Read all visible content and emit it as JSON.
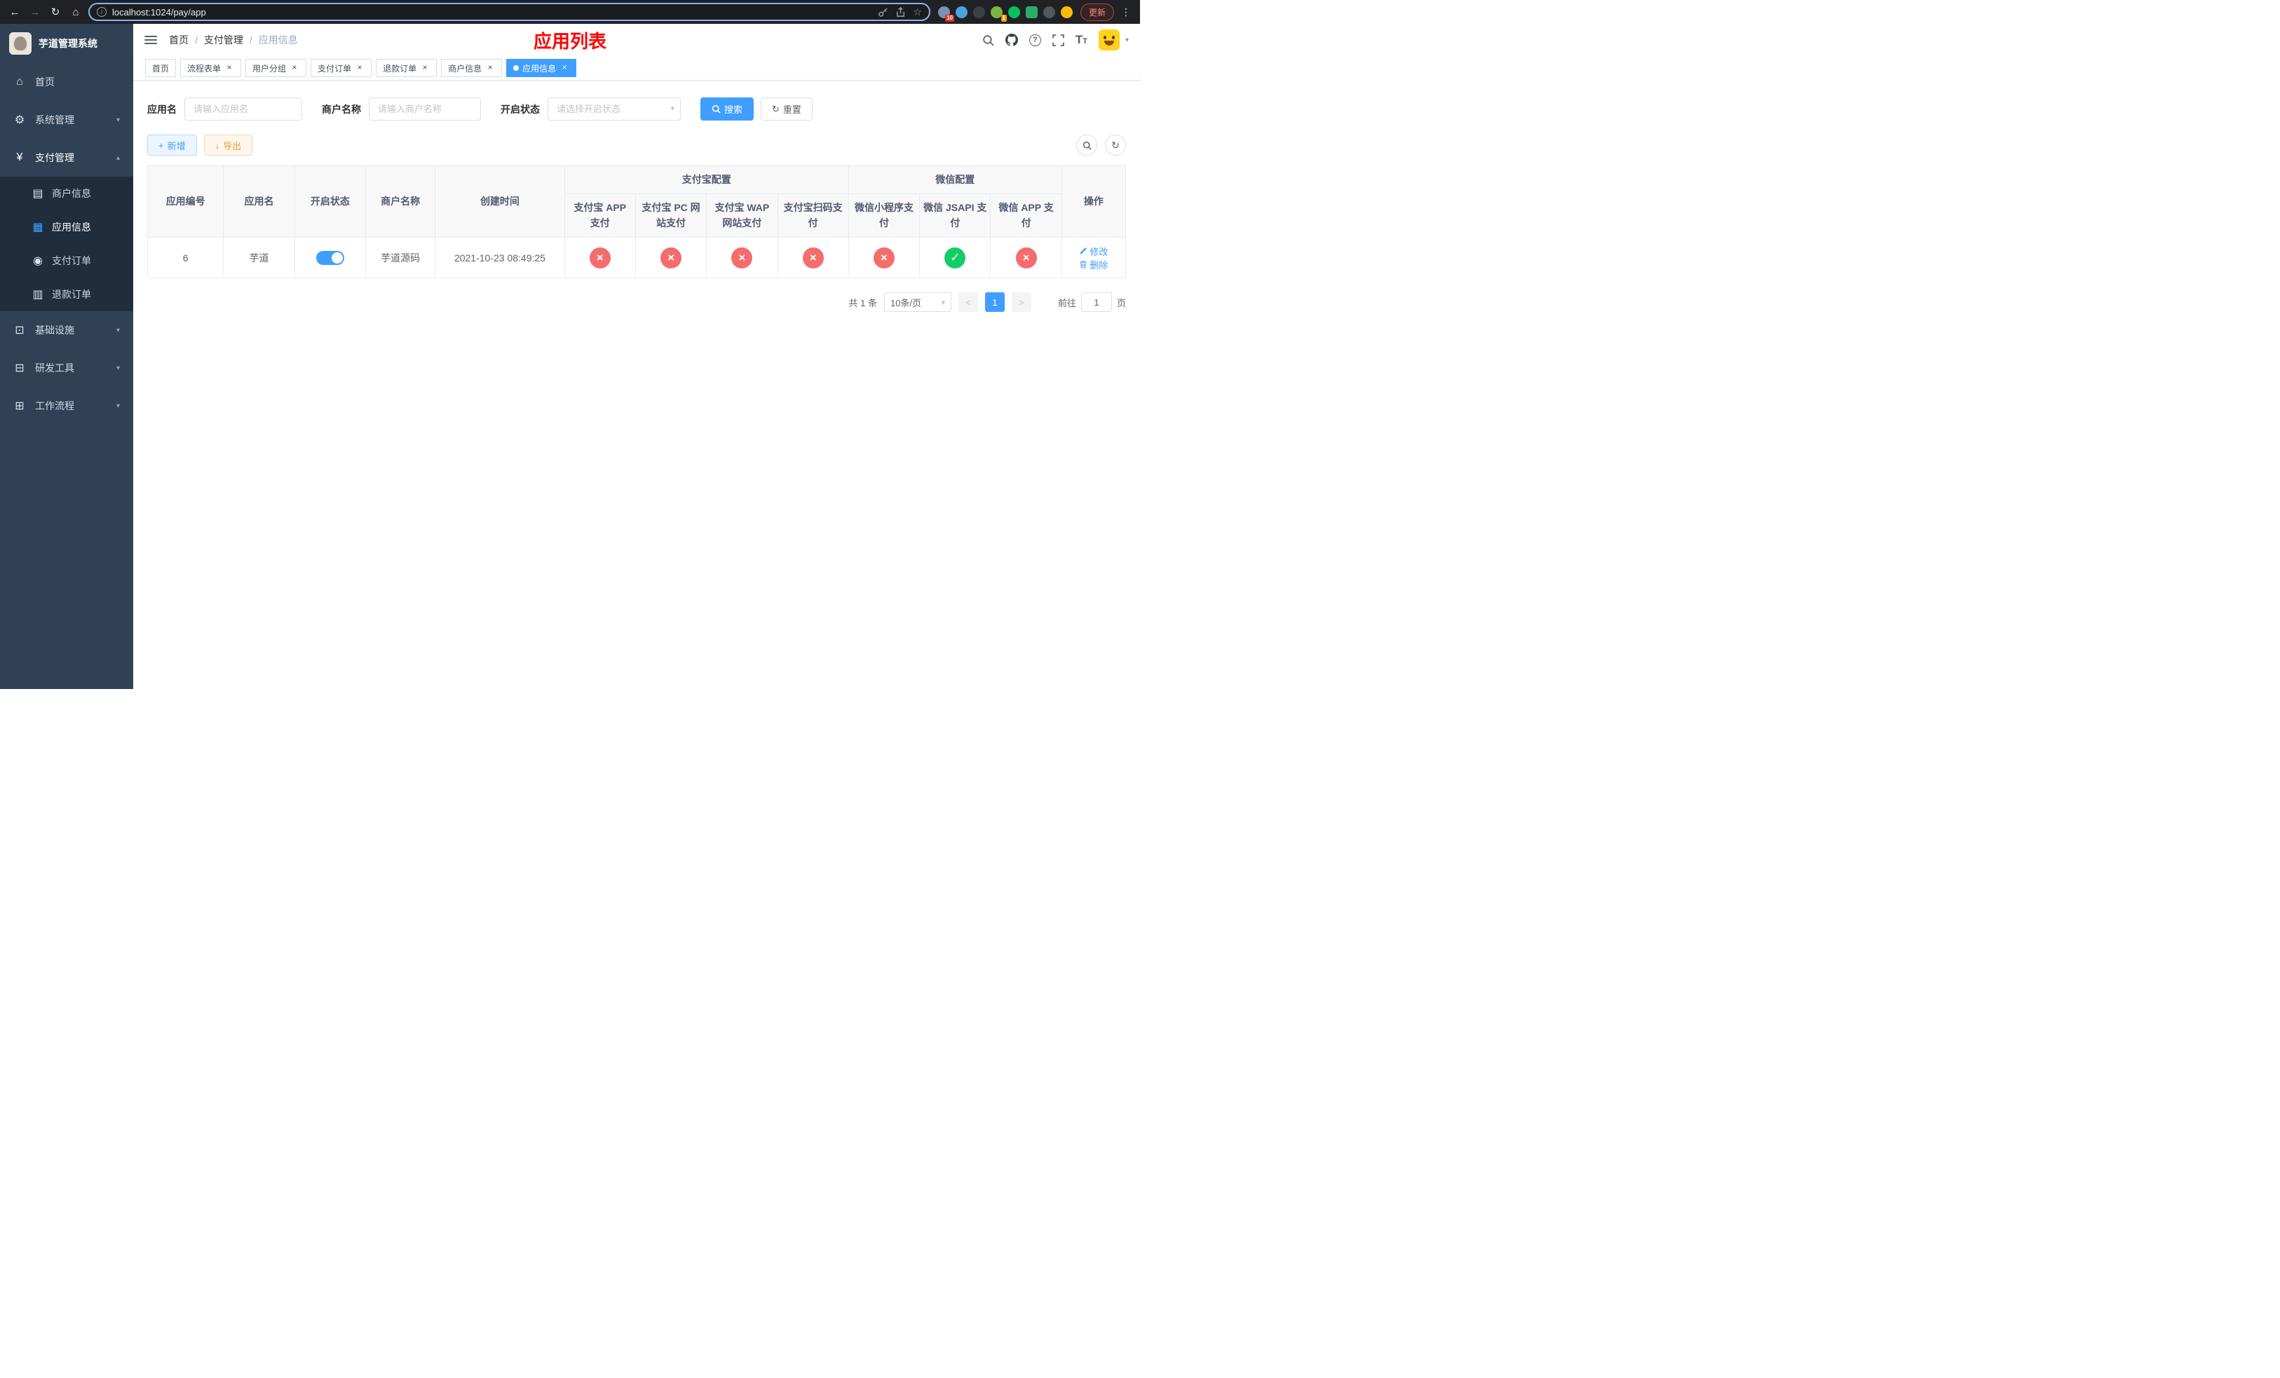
{
  "icons": {
    "back": "←",
    "forward": "→",
    "reload": "↻",
    "home": "⌂",
    "star": "☆",
    "kebab": "⋮",
    "info": "i",
    "question": "?",
    "close": "×",
    "chevron_down": "▾",
    "chevron_up": "▴",
    "plus": "+",
    "download": "↓",
    "refresh": "↻",
    "search_glyph": "⌕",
    "check": "✓",
    "cross": "×",
    "slash": "/",
    "home_menu": "⌂",
    "gear": "⚙",
    "yen": "¥",
    "card": "▤",
    "grid": "▦",
    "order": "◉",
    "refund": "▥",
    "infra": "⊡",
    "tools": "⊟",
    "flow": "⊞",
    "text_size_big": "T",
    "text_size_small": "T"
  },
  "browser": {
    "url": "localhost:1024/pay/app",
    "update_label": "更新",
    "ext_badge_a": "10",
    "ext_badge_b": "1"
  },
  "sidebar": {
    "title": "芋道管理系统",
    "items": [
      {
        "label": "首页"
      },
      {
        "label": "系统管理"
      },
      {
        "label": "支付管理"
      },
      {
        "label": "基础设施"
      },
      {
        "label": "研发工具"
      },
      {
        "label": "工作流程"
      }
    ],
    "sub_items": [
      {
        "label": "商户信息"
      },
      {
        "label": "应用信息"
      },
      {
        "label": "支付订单"
      },
      {
        "label": "退款订单"
      }
    ]
  },
  "header": {
    "breadcrumb": [
      "首页",
      "支付管理",
      "应用信息"
    ],
    "title": "应用列表"
  },
  "tabs": [
    {
      "label": "首页"
    },
    {
      "label": "流程表单"
    },
    {
      "label": "用户分组"
    },
    {
      "label": "支付订单"
    },
    {
      "label": "退款订单"
    },
    {
      "label": "商户信息"
    },
    {
      "label": "应用信息"
    }
  ],
  "filters": {
    "app_name_label": "应用名",
    "app_name_placeholder": "请输入应用名",
    "merchant_label": "商户名称",
    "merchant_placeholder": "请输入商户名称",
    "status_label": "开启状态",
    "status_placeholder": "请选择开启状态",
    "search_label": "搜索",
    "reset_label": "重置"
  },
  "toolbar": {
    "add_label": "新增",
    "export_label": "导出"
  },
  "table": {
    "col_app_id": "应用编号",
    "col_app_name": "应用名",
    "col_status": "开启状态",
    "col_merchant": "商户名称",
    "col_created": "创建时间",
    "group_alipay": "支付宝配置",
    "group_wechat": "微信配置",
    "col_alipay_app": "支付宝 APP 支付",
    "col_alipay_pc": "支付宝 PC 网站支付",
    "col_alipay_wap": "支付宝 WAP 网站支付",
    "col_alipay_qr": "支付宝扫码支付",
    "col_wx_mini": "微信小程序支付",
    "col_wx_jsapi": "微信 JSAPI 支付",
    "col_wx_app": "微信 APP 支付",
    "col_actions": "操作",
    "rows": [
      {
        "id": "6",
        "name": "芋道",
        "enabled": true,
        "merchant": "芋道源码",
        "created": "2021-10-23 08:49:25",
        "channels": [
          "cross",
          "cross",
          "cross",
          "cross",
          "cross",
          "check",
          "cross"
        ],
        "edit": "修改",
        "delete": "删除"
      }
    ]
  },
  "pagination": {
    "total": "共 1 条",
    "page_size": "10条/页",
    "page": "1",
    "goto_label": "前往",
    "goto_value": "1",
    "goto_unit": "页"
  }
}
